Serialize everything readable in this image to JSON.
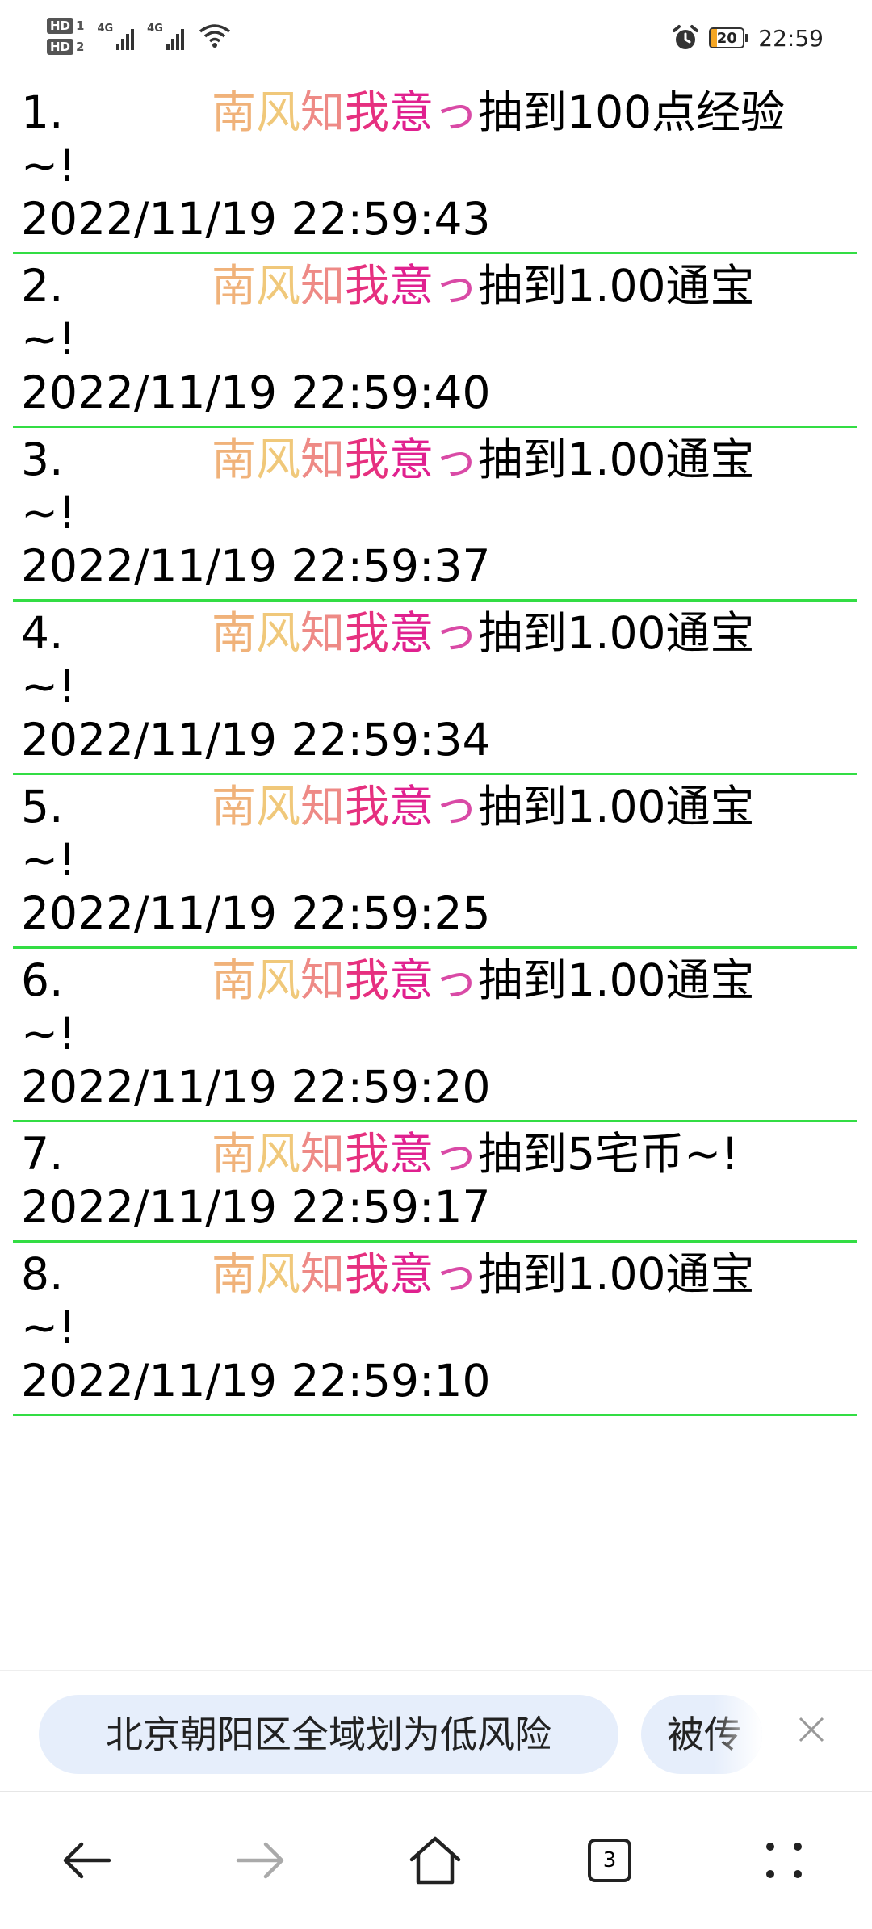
{
  "status_bar": {
    "sim1": "HD",
    "sim1_num": "1",
    "sim2": "HD",
    "sim2_num": "2",
    "net1": "4G",
    "net2": "4G",
    "battery_level": "20",
    "time": "22:59",
    "icons": [
      "alarm-icon",
      "wifi-icon",
      "signal-icon",
      "battery-icon"
    ]
  },
  "entries": [
    {
      "index": "1.",
      "name_chars": [
        "南",
        "风",
        "知",
        "我",
        "意",
        "っ"
      ],
      "action": "抽到100点经验",
      "tail": "~!",
      "timestamp": "2022/11/19 22:59:43"
    },
    {
      "index": "2.",
      "name_chars": [
        "南",
        "风",
        "知",
        "我",
        "意",
        "っ"
      ],
      "action": "抽到1.00通宝",
      "tail": "~!",
      "timestamp": "2022/11/19 22:59:40"
    },
    {
      "index": "3.",
      "name_chars": [
        "南",
        "风",
        "知",
        "我",
        "意",
        "っ"
      ],
      "action": "抽到1.00通宝",
      "tail": "~!",
      "timestamp": "2022/11/19 22:59:37"
    },
    {
      "index": "4.",
      "name_chars": [
        "南",
        "风",
        "知",
        "我",
        "意",
        "っ"
      ],
      "action": "抽到1.00通宝",
      "tail": "~!",
      "timestamp": "2022/11/19 22:59:34"
    },
    {
      "index": "5.",
      "name_chars": [
        "南",
        "风",
        "知",
        "我",
        "意",
        "っ"
      ],
      "action": "抽到1.00通宝",
      "tail": "~!",
      "timestamp": "2022/11/19 22:59:25"
    },
    {
      "index": "6.",
      "name_chars": [
        "南",
        "风",
        "知",
        "我",
        "意",
        "っ"
      ],
      "action": "抽到1.00通宝",
      "tail": "~!",
      "timestamp": "2022/11/19 22:59:20"
    },
    {
      "index": "7.",
      "name_chars": [
        "南",
        "风",
        "知",
        "我",
        "意",
        "っ"
      ],
      "action": "抽到5宅币~!",
      "tail": "",
      "timestamp": "2022/11/19 22:59:17"
    },
    {
      "index": "8.",
      "name_chars": [
        "南",
        "风",
        "知",
        "我",
        "意",
        "っ"
      ],
      "action": "抽到1.00通宝",
      "tail": "~!",
      "timestamp": "2022/11/19 22:59:10"
    }
  ],
  "name_colors": [
    "#f0b27a",
    "#f0c87a",
    "#ee8a86",
    "#e6307f",
    "#e0208f",
    "#d94aa6"
  ],
  "separator_color": "#33dd44",
  "news": {
    "chip1": "北京朝阳区全域划为低风险",
    "chip2": "被传",
    "close_icon": "close-icon"
  },
  "nav": {
    "tab_count": "3",
    "icons": [
      "back-arrow-icon",
      "forward-arrow-icon",
      "home-icon",
      "tabs-icon",
      "menu-dots-icon"
    ]
  }
}
